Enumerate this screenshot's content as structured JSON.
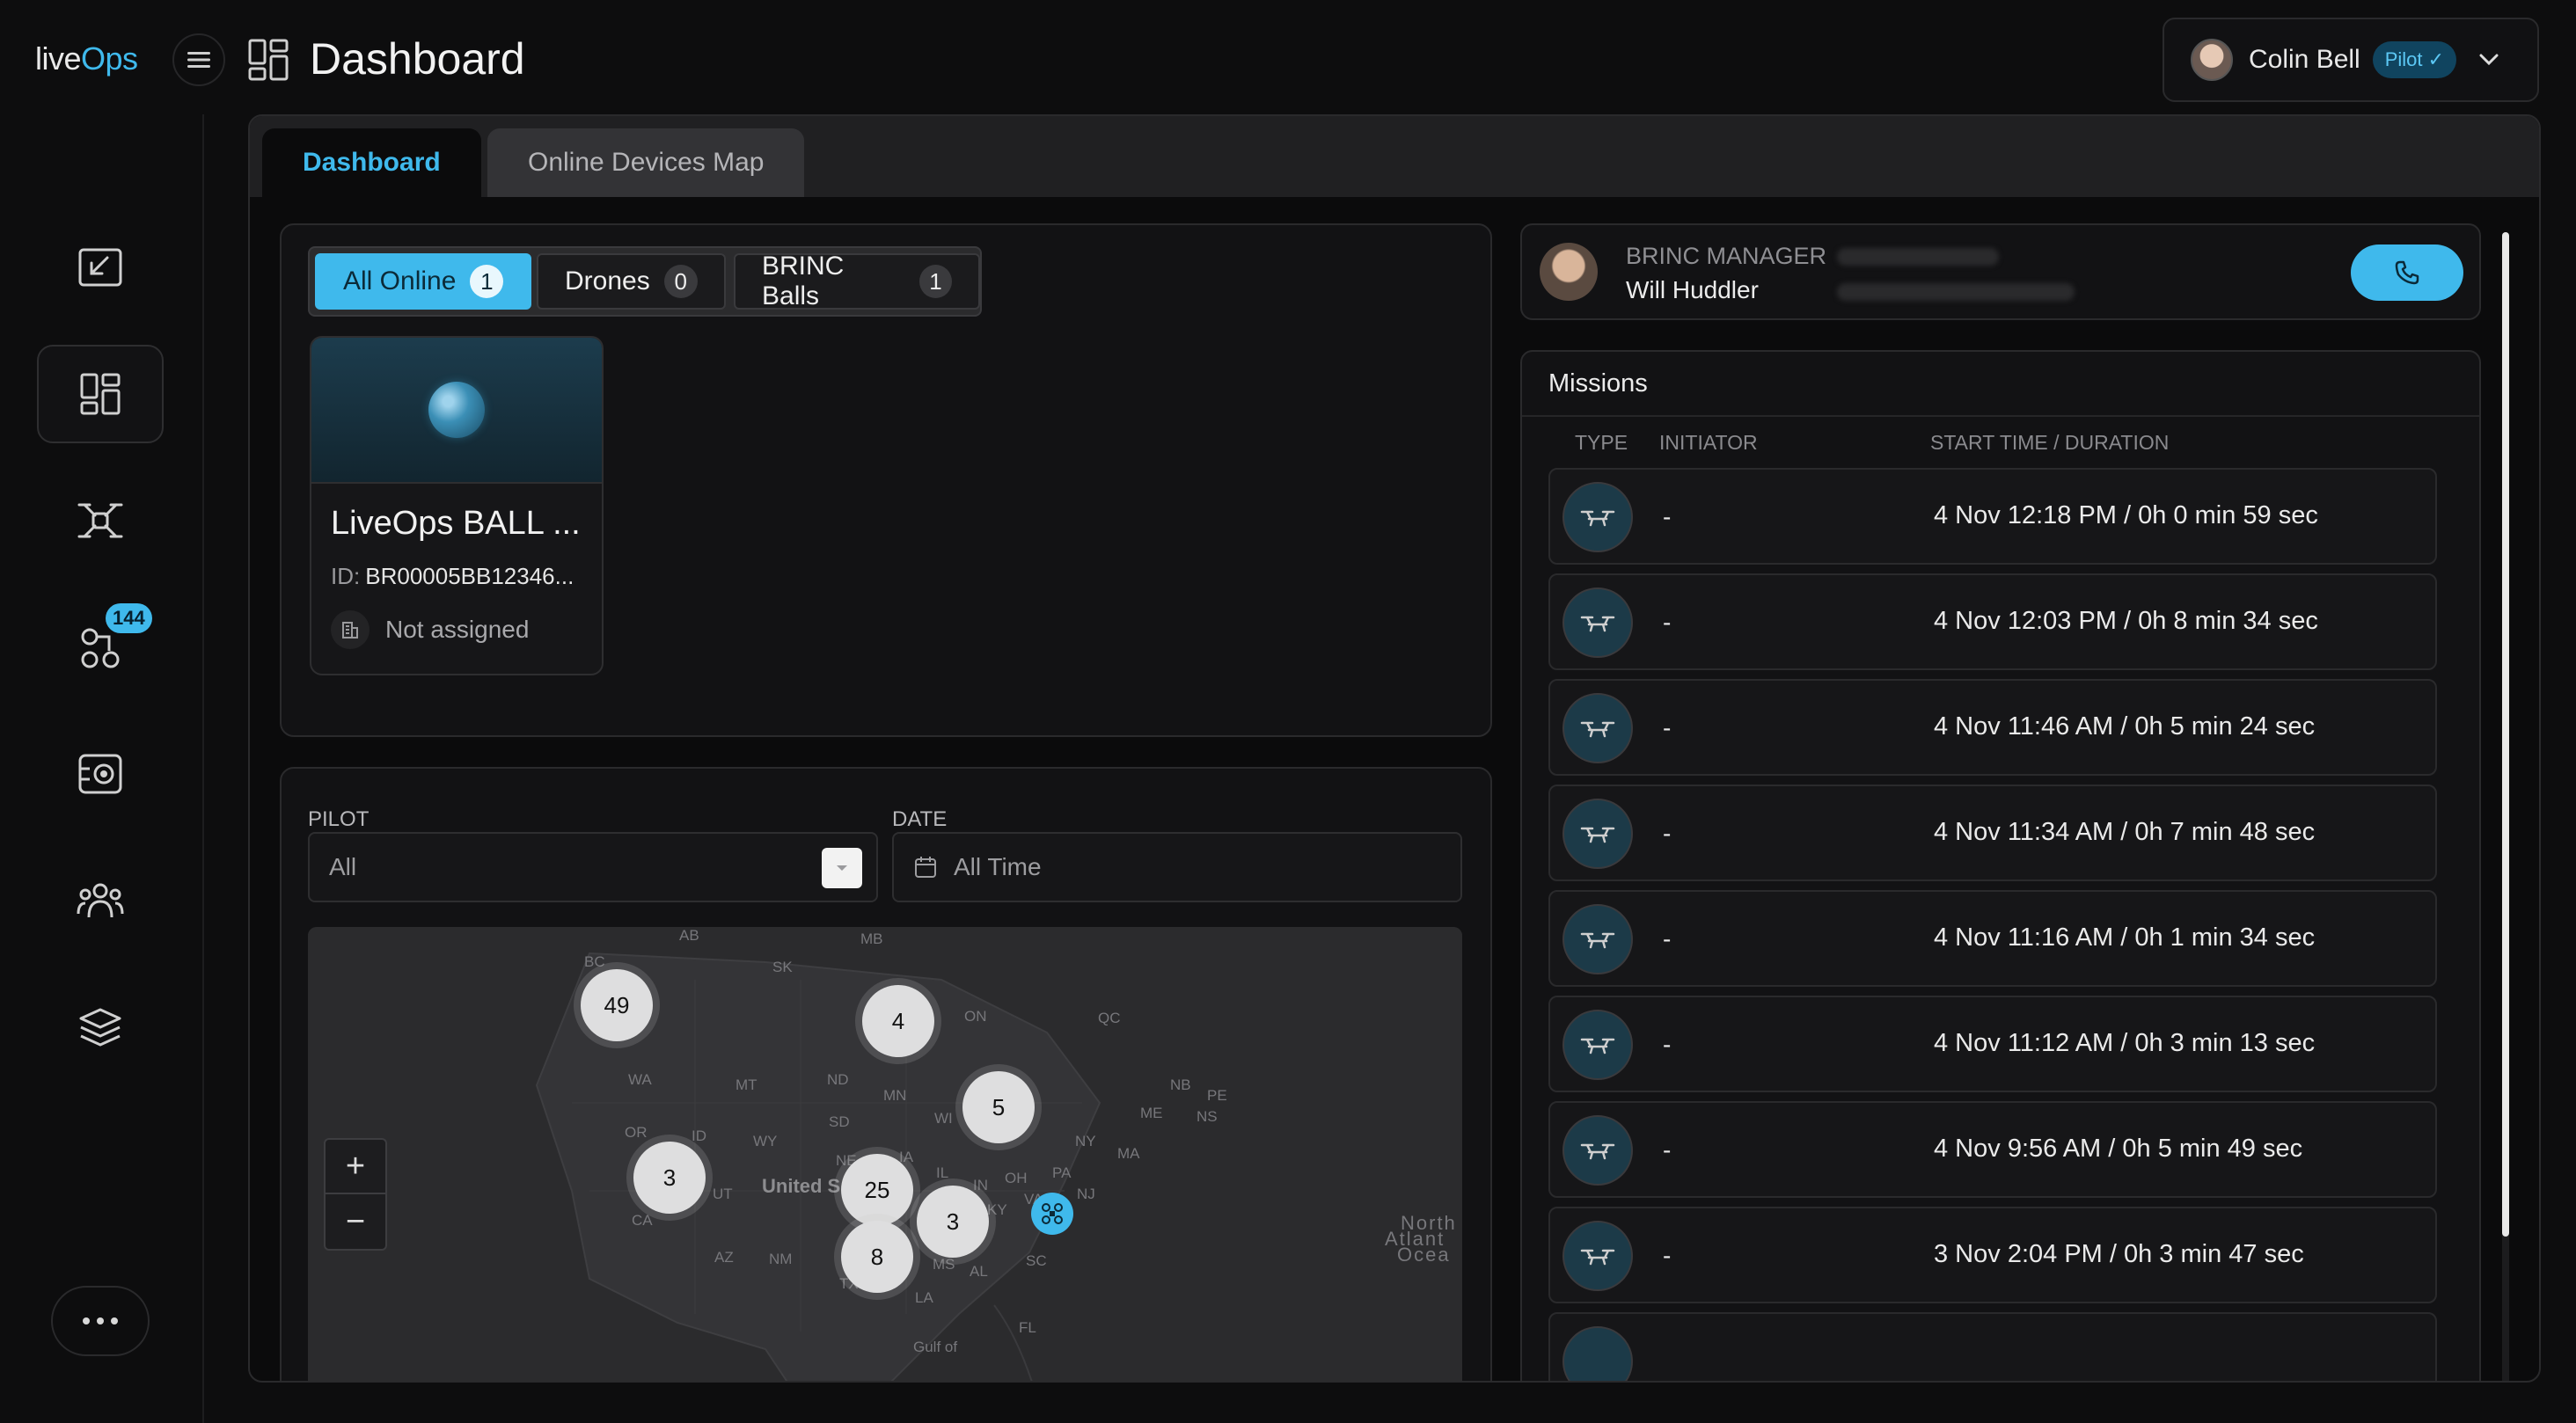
{
  "app": {
    "logo_left": "live",
    "logo_right": "Ops",
    "page_title": "Dashboard"
  },
  "user": {
    "name": "Colin Bell",
    "role": "Pilot ✓"
  },
  "rail": {
    "badge_count": "144"
  },
  "tabs": [
    {
      "label": "Dashboard"
    },
    {
      "label": "Online Devices Map"
    }
  ],
  "filters": [
    {
      "label": "All Online",
      "count": "1"
    },
    {
      "label": "Drones",
      "count": "0"
    },
    {
      "label": "BRINC Balls",
      "count": "1"
    }
  ],
  "device": {
    "name": "LiveOps BALL ...",
    "id_label": "ID:",
    "id_value": "BR00005BB12346...",
    "assignment": "Not assigned"
  },
  "history": {
    "pilot_label": "PILOT",
    "pilot_value": "All",
    "date_label": "DATE",
    "date_value": "All Time"
  },
  "map": {
    "clusters": [
      "49",
      "4",
      "5",
      "3",
      "25",
      "3",
      "8"
    ],
    "labels": [
      "AB",
      "SK",
      "MB",
      "BC",
      "ON",
      "QC",
      "WA",
      "MT",
      "ND",
      "MN",
      "NB",
      "PE",
      "ME",
      "NS",
      "OR",
      "ID",
      "WY",
      "SD",
      "WI",
      "NY",
      "MA",
      "NE",
      "IA",
      "IL",
      "IN",
      "OH",
      "PA",
      "NJ",
      "UT",
      "United S",
      "CA",
      "AZ",
      "NM",
      "KY",
      "VA",
      "MS",
      "AL",
      "SC",
      "TX",
      "LA",
      "FL",
      "Gulf of",
      "North",
      "Atlant",
      "Ocea"
    ],
    "zoom_in": "+",
    "zoom_out": "−"
  },
  "manager": {
    "role": "BRINC MANAGER",
    "name": "Will Huddler"
  },
  "missions": {
    "title": "Missions",
    "headers": {
      "type": "TYPE",
      "initiator": "INITIATOR",
      "start": "START TIME / DURATION"
    },
    "rows": [
      {
        "initiator": "-",
        "start": "4 Nov 12:18 PM / 0h 0 min 59 sec"
      },
      {
        "initiator": "-",
        "start": "4 Nov 12:03 PM / 0h 8 min 34 sec"
      },
      {
        "initiator": "-",
        "start": "4 Nov 11:46 AM / 0h 5 min 24 sec"
      },
      {
        "initiator": "-",
        "start": "4 Nov 11:34 AM / 0h 7 min 48 sec"
      },
      {
        "initiator": "-",
        "start": "4 Nov 11:16 AM / 0h 1 min 34 sec"
      },
      {
        "initiator": "-",
        "start": "4 Nov 11:12 AM / 0h 3 min 13 sec"
      },
      {
        "initiator": "-",
        "start": "4 Nov 9:56 AM / 0h 5 min 49 sec"
      },
      {
        "initiator": "-",
        "start": "3 Nov 2:04 PM / 0h 3 min 47 sec"
      }
    ]
  },
  "colors": {
    "accent": "#3fb9ec",
    "background": "#0d0d0e",
    "panel": "#121214"
  },
  "icons": {
    "rail": [
      "exit-arrow-icon",
      "dashboard-icon",
      "drone-icon",
      "devices-icon",
      "camera-icon",
      "users-icon",
      "layers-icon"
    ]
  }
}
